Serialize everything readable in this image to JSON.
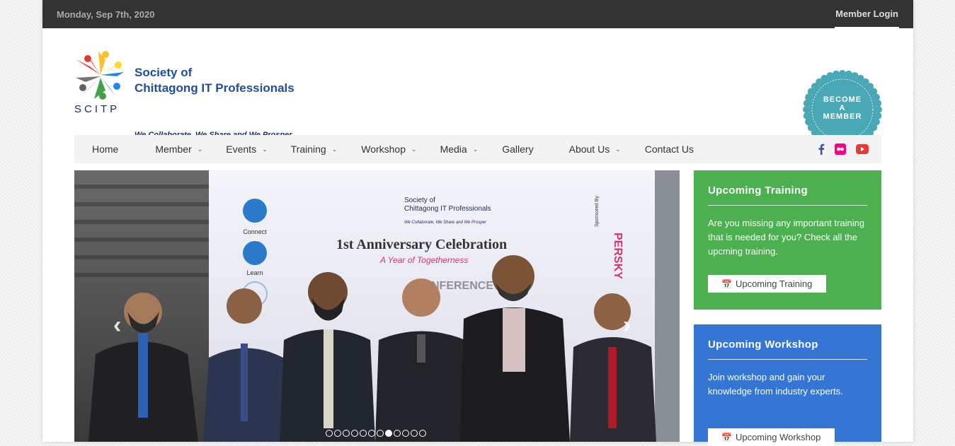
{
  "topbar": {
    "date": "Monday, Sep 7th, 2020",
    "login": "Member Login"
  },
  "logo": {
    "line1": "Society of",
    "line2": "Chittagong IT Professionals",
    "abbr": "SCITP",
    "tagline": "We Collaborate, We Share and We Prosper"
  },
  "badge": {
    "line1": "BECOME",
    "line2": "A",
    "line3": "MEMBER",
    "color": "#4aa8b4"
  },
  "nav": {
    "items": [
      {
        "label": "Home"
      },
      {
        "label": "Member"
      },
      {
        "label": "Events"
      },
      {
        "label": "Training"
      },
      {
        "label": "Workshop"
      },
      {
        "label": "Media"
      },
      {
        "label": "Gallery"
      },
      {
        "label": "About Us"
      },
      {
        "label": "Contact Us"
      }
    ],
    "social": [
      "facebook-icon",
      "flickr-icon",
      "youtube-icon"
    ]
  },
  "slider": {
    "banner_org_line1": "Society of",
    "banner_org_line2": "Chittagong IT Professionals",
    "banner_tagline": "We Collaborate, We Share and We Prosper",
    "banner_title": "1st Anniversary Celebration",
    "banner_subtitle": "A Year of Togetherness",
    "connect": "Connect",
    "learn": "Learn",
    "sponsor": "Sponsored By",
    "sponsor_name": "PERSKY",
    "conference": "CONFERENCE",
    "dots_total": 12,
    "dots_active": 8
  },
  "training": {
    "title": "Upcoming Training",
    "text": "Are you missing any important training that is needed for you? Check all the upcming training.",
    "button": "Upcoming Training",
    "color": "#4caf50"
  },
  "workshop": {
    "title": "Upcoming Workshop",
    "text": "Join workshop and gain your knowledge from industry experts.",
    "button": "Upcoming Workshop",
    "color": "#3575d3"
  }
}
